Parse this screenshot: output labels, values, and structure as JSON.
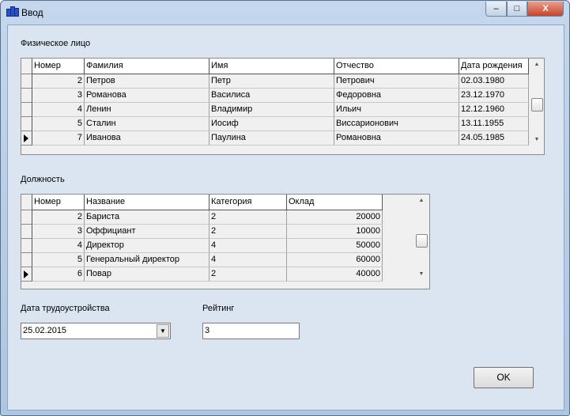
{
  "window": {
    "title": "Ввод",
    "minimize": "–",
    "maximize": "□",
    "close": "X"
  },
  "person": {
    "label": "Физическое лицо",
    "columns": [
      "Номер",
      "Фамилия",
      "Имя",
      "Отчество",
      "Дата рождения"
    ],
    "rows": [
      [
        "2",
        "Петров",
        "Петр",
        "Петрович",
        "02.03.1980"
      ],
      [
        "3",
        "Романова",
        "Василиса",
        "Федоровна",
        "23.12.1970"
      ],
      [
        "4",
        "Ленин",
        "Владимир",
        "Ильич",
        "12.12.1960"
      ],
      [
        "5",
        "Сталин",
        "Иосиф",
        "Виссарионович",
        "13.11.1955"
      ],
      [
        "7",
        "Иванова",
        "Паулина",
        "Романовна",
        "24.05.1985"
      ]
    ],
    "current_row": 4
  },
  "position": {
    "label": "Должность",
    "columns": [
      "Номер",
      "Название",
      "Категория",
      "Оклад"
    ],
    "rows": [
      [
        "2",
        "Бариста",
        "2",
        "20000"
      ],
      [
        "3",
        "Оффициант",
        "2",
        "10000"
      ],
      [
        "4",
        "Директор",
        "4",
        "50000"
      ],
      [
        "5",
        "Генеральный директор",
        "4",
        "60000"
      ],
      [
        "6",
        "Повар",
        "2",
        "40000"
      ]
    ],
    "current_row": 4
  },
  "hire_date": {
    "label": "Дата трудоустройства",
    "value": "25.02.2015"
  },
  "rating": {
    "label": "Рейтинг",
    "value": "3"
  },
  "ok_label": "OK"
}
